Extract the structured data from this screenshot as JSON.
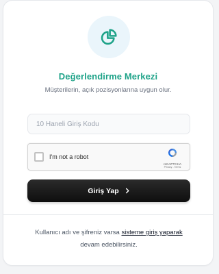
{
  "header": {
    "title": "Değerlendirme Merkezi",
    "subtitle": "Müşterilerin, açık pozisyonlarına uygun olur.",
    "logo_icon": "pie-chart-icon",
    "accent_color": "#1fa389"
  },
  "form": {
    "code_placeholder": "10 Haneli Giriş Kodu",
    "code_value": "",
    "recaptcha": {
      "label": "I'm not a robot",
      "brand": "reCAPTCHA",
      "links": "Privacy - Terms",
      "checked": false
    },
    "submit_label": "Giriş Yap",
    "submit_icon": "chevron-right-icon"
  },
  "footer": {
    "text_before": "Kullanıcı adı ve şifreniz varsa",
    "link_text": "sisteme giriş yaparak",
    "text_after": "devam edebilirsiniz."
  }
}
